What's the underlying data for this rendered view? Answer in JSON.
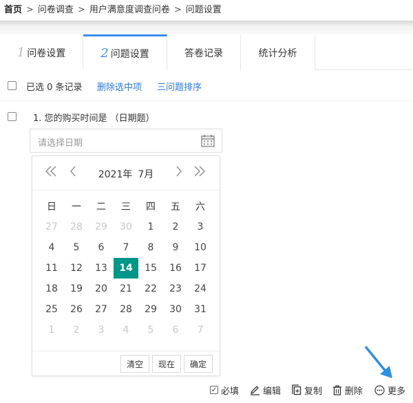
{
  "breadcrumb": {
    "home": "首页",
    "sep": ">",
    "items": [
      "问卷调查",
      "用户满意度调查问卷",
      "问题设置"
    ]
  },
  "tabs": [
    {
      "num": "1",
      "label": "问卷设置"
    },
    {
      "num": "2",
      "label": "问题设置"
    },
    {
      "label": "答卷记录"
    },
    {
      "label": "统计分析"
    }
  ],
  "toolbar": {
    "selected_text": "已选 0 条记录",
    "delete_selected": "删除选中项",
    "sort_questions": "三问题排序"
  },
  "question": {
    "title": "1. 您的购买时间是 （日期题）",
    "placeholder": "请选择日期"
  },
  "datepicker": {
    "year": "2021年",
    "month": "7月",
    "weekdays": [
      "日",
      "一",
      "二",
      "三",
      "四",
      "五",
      "六"
    ],
    "weeks": [
      [
        "27",
        "28",
        "29",
        "30",
        "1",
        "2",
        "3"
      ],
      [
        "4",
        "5",
        "6",
        "7",
        "8",
        "9",
        "10"
      ],
      [
        "11",
        "12",
        "13",
        "14",
        "15",
        "16",
        "17"
      ],
      [
        "18",
        "19",
        "20",
        "21",
        "22",
        "23",
        "24"
      ],
      [
        "25",
        "26",
        "27",
        "28",
        "29",
        "30",
        "31"
      ],
      [
        "1",
        "2",
        "3",
        "4",
        "5",
        "6",
        "7"
      ]
    ],
    "selected_day": "14",
    "clear": "清空",
    "now": "现在",
    "confirm": "确定"
  },
  "actions": {
    "required": "必填",
    "edit": "编辑",
    "copy": "复制",
    "delete": "删除",
    "more": "更多"
  },
  "colors": {
    "accent": "#3c8ef0",
    "link": "#2a7ae2",
    "selected": "#009688",
    "arrow": "#2f8fe0"
  }
}
